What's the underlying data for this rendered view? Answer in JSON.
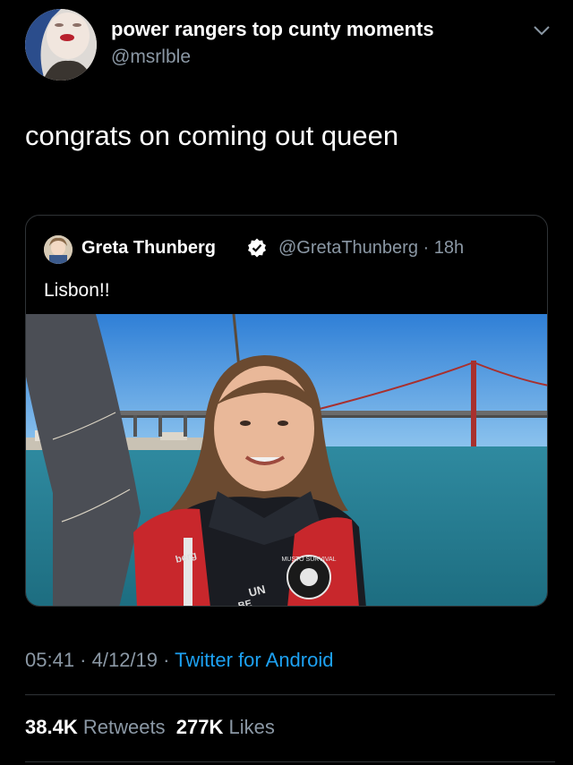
{
  "author": {
    "display_name": "power rangers top cunty moments",
    "handle": "@msrlble",
    "avatar_icon": "profile-photo",
    "menu_icon": "chevron-down-icon"
  },
  "tweet": {
    "text": "congrats on coming out queen"
  },
  "quoted_tweet": {
    "display_name": "Greta Thunberg",
    "verified_icon": "verified-badge-icon",
    "handle_time": "@GretaThunberg · 18h",
    "text": "Lisbon!!",
    "photo": {
      "jacket_text_1": "berg",
      "jacket_text_2": "UN",
      "jacket_text_3": "BE",
      "badge_text": "MUSTO SURVIVAL"
    }
  },
  "meta": {
    "time_date": "05:41 · 4/12/19 · ",
    "source": "Twitter for Android"
  },
  "stats": {
    "retweets_count": "38.4K",
    "retweets_label": "Retweets",
    "likes_count": "277K",
    "likes_label": "Likes"
  },
  "colors": {
    "background": "#000000",
    "secondary_text": "#8b98a5",
    "link": "#1da1f2",
    "divider": "#2f3336"
  }
}
